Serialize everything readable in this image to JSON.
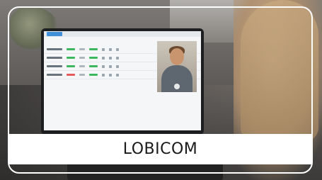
{
  "caption": {
    "text": "LOBICOM"
  },
  "laptop_screen": {
    "rows": [
      {
        "status": "green"
      },
      {
        "status": "green"
      },
      {
        "status": "green"
      },
      {
        "status": "red"
      }
    ],
    "colors": {
      "tab": "#3f8fd9",
      "ok": "#3cb95f",
      "alert": "#e55a5a"
    }
  },
  "icons": {
    "video_control": "video-control-icon"
  }
}
